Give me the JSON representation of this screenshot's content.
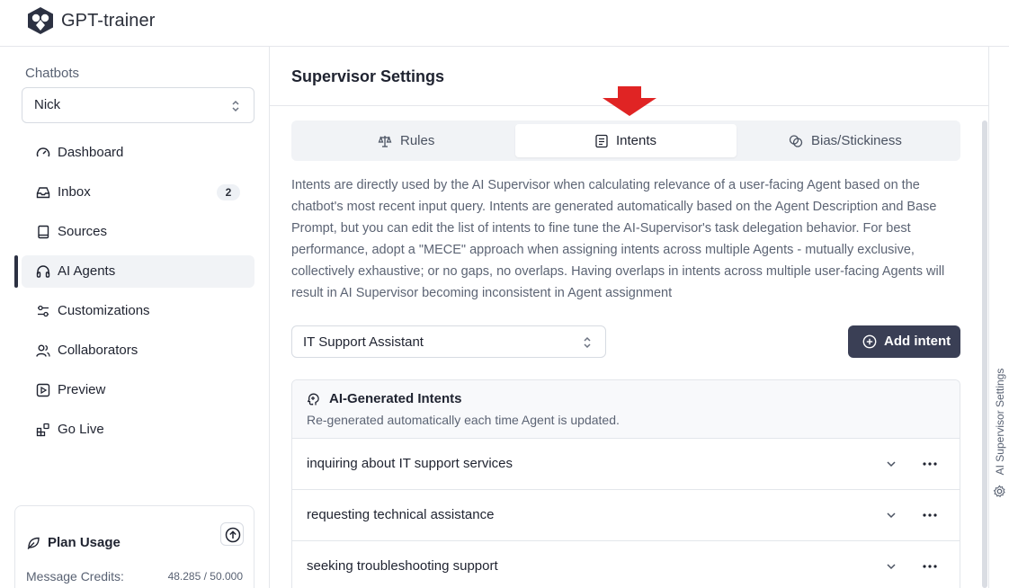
{
  "app": {
    "brand": "GPT-trainer"
  },
  "sidebar": {
    "section_label": "Chatbots",
    "chatbot_select": {
      "value": "Nick"
    },
    "items": [
      {
        "label": "Dashboard",
        "icon": "gauge-icon"
      },
      {
        "label": "Inbox",
        "icon": "inbox-icon",
        "badge": "2"
      },
      {
        "label": "Sources",
        "icon": "book-icon"
      },
      {
        "label": "AI Agents",
        "icon": "headphones-icon",
        "active": true
      },
      {
        "label": "Customizations",
        "icon": "sliders-icon"
      },
      {
        "label": "Collaborators",
        "icon": "users-icon"
      },
      {
        "label": "Preview",
        "icon": "play-square-icon"
      },
      {
        "label": "Go Live",
        "icon": "widgets-icon"
      }
    ],
    "plan_usage": {
      "title": "Plan Usage",
      "message_credits_label": "Message Credits:",
      "message_credits_value": "48.285 / 50.000"
    }
  },
  "main": {
    "title": "Supervisor Settings",
    "tabs": [
      {
        "label": "Rules",
        "icon": "scale-icon"
      },
      {
        "label": "Intents",
        "icon": "list-doc-icon",
        "active": true
      },
      {
        "label": "Bias/Stickiness",
        "icon": "overlap-circles-icon"
      }
    ],
    "description": "Intents are directly used by the AI Supervisor when calculating relevance of a user-facing Agent based on the chatbot's most recent input query. Intents are generated automatically based on the Agent Description and Base Prompt, but you can edit the list of intents to fine tune the AI-Supervisor's task delegation behavior. For best performance, adopt a \"MECE\" approach when assigning intents across multiple Agents - mutually exclusive, collectively exhaustive; or no gaps, no overlaps. Having overlaps in intents across multiple user-facing Agents will result in AI Supervisor becoming inconsistent in Agent assignment",
    "agent_select": {
      "value": "IT Support Assistant"
    },
    "add_intent_label": "Add intent",
    "panel": {
      "title": "AI-Generated Intents",
      "subtitle": "Re-generated automatically each time Agent is updated.",
      "intents": [
        "inquiring about IT support services",
        "requesting technical assistance",
        "seeking troubleshooting support"
      ]
    }
  },
  "right_panel": {
    "label": "AI Supervisor Settings"
  },
  "colors": {
    "primary_button": "#3a3f55",
    "annotation_arrow": "#e02424"
  }
}
